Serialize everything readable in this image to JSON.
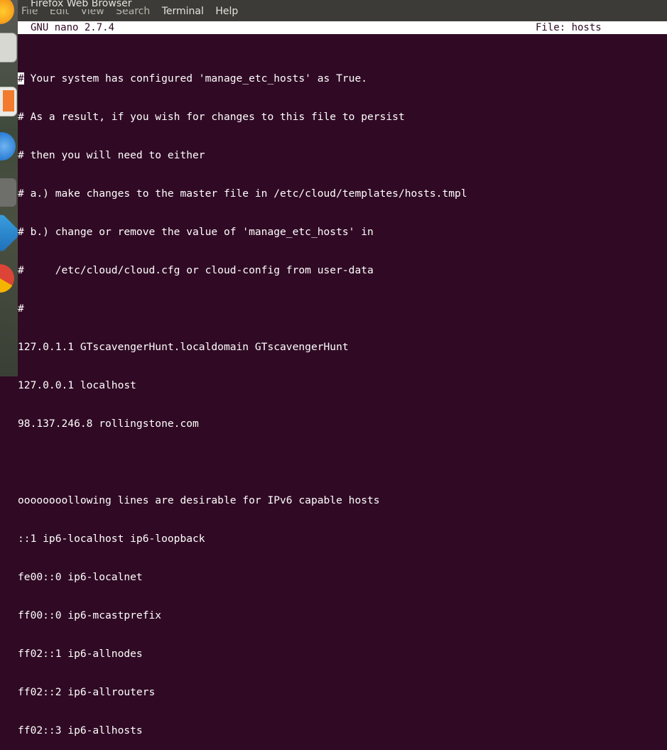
{
  "window": {
    "title": "Firefox Web Browser"
  },
  "menu": {
    "items": [
      "File",
      "Edit",
      "View",
      "Search",
      "Terminal",
      "Help"
    ]
  },
  "nano": {
    "version": "GNU nano 2.7.4",
    "file_label": "File: hosts"
  },
  "editor": {
    "cursor_char": "#",
    "lines": [
      " Your system has configured 'manage_etc_hosts' as True.",
      "# As a result, if you wish for changes to this file to persist",
      "# then you will need to either",
      "# a.) make changes to the master file in /etc/cloud/templates/hosts.tmpl",
      "# b.) change or remove the value of 'manage_etc_hosts' in",
      "#     /etc/cloud/cloud.cfg or cloud-config from user-data",
      "#",
      "127.0.1.1 GTscavengerHunt.localdomain GTscavengerHunt",
      "127.0.0.1 localhost",
      "98.137.246.8 rollingstone.com",
      "",
      "oooooooollowing lines are desirable for IPv6 capable hosts",
      "::1 ip6-localhost ip6-loopback",
      "fe00::0 ip6-localnet",
      "ff00::0 ip6-mcastprefix",
      "ff02::1 ip6-allnodes",
      "ff02::2 ip6-allrouters",
      "ff02::3 ip6-allhosts"
    ]
  },
  "launcher": {
    "icons": [
      "firefox-icon",
      "files-icon",
      "libreoffice-icon",
      "software-center-icon",
      "settings-icon",
      "virtualbox-icon",
      "chrome-icon"
    ]
  }
}
